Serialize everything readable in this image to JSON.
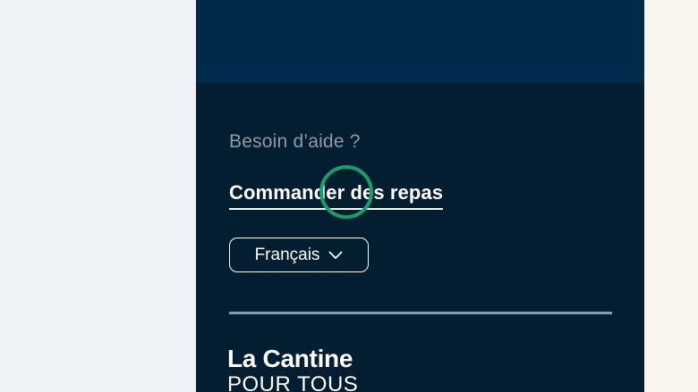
{
  "footer": {
    "help_label": "Besoin d’aide ?",
    "order_link": "Commander des repas",
    "language": {
      "selected": "Français",
      "icon": "chevron-down-icon"
    },
    "logo": {
      "line1": "La Cantine",
      "line2": "POUR TOUS"
    }
  },
  "colors": {
    "panel_top": "#002a4b",
    "panel": "#031d31",
    "cursor_ring": "#14a06a",
    "page_left": "#eff3f8",
    "page_right": "#f9f5ef"
  }
}
